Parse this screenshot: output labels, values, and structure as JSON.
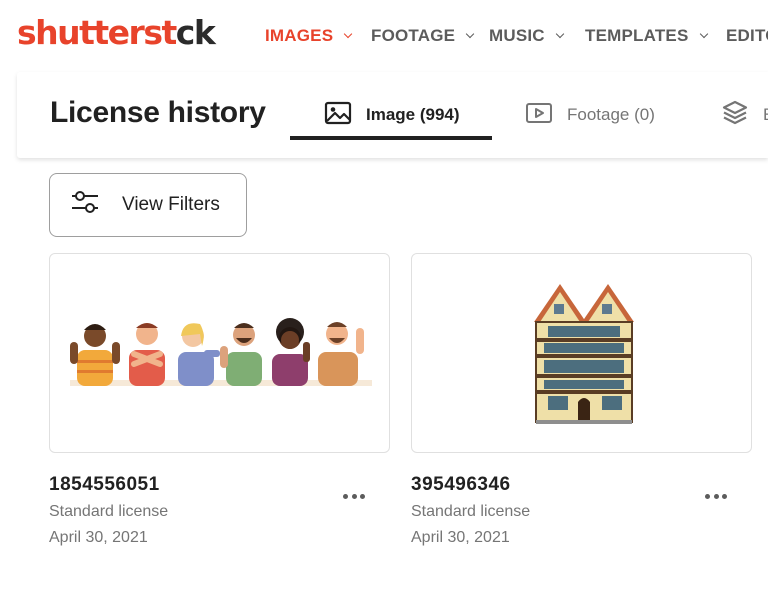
{
  "brand": {
    "logo_part1": "shutterst",
    "logo_part2": "ck",
    "accent": "#e8432b"
  },
  "nav": {
    "items": [
      {
        "label": "IMAGES",
        "active": true
      },
      {
        "label": "FOOTAGE",
        "active": false
      },
      {
        "label": "MUSIC",
        "active": false
      },
      {
        "label": "TEMPLATES",
        "active": false
      },
      {
        "label": "EDITO",
        "active": false
      }
    ]
  },
  "header": {
    "title": "License history",
    "tabs": [
      {
        "label": "Image (994)",
        "icon": "image-icon",
        "active": true
      },
      {
        "label": "Footage (0)",
        "icon": "video-icon",
        "active": false
      },
      {
        "label": "E",
        "icon": "layers-icon",
        "active": false
      }
    ]
  },
  "filters": {
    "label": "View Filters"
  },
  "cards": [
    {
      "id": "1854556051",
      "license": "Standard license",
      "date": "April 30, 2021",
      "thumbnail": "diverse-people-illustration"
    },
    {
      "id": "395496346",
      "license": "Standard license",
      "date": "April 30, 2021",
      "thumbnail": "tudor-house-illustration"
    }
  ]
}
